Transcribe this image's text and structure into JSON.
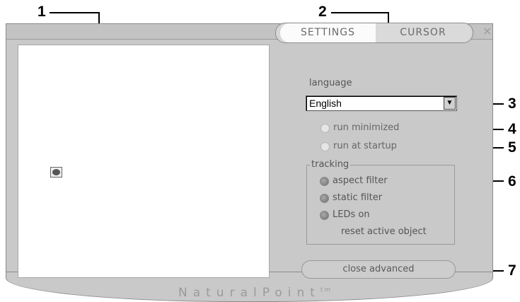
{
  "callouts": [
    "1",
    "2",
    "3",
    "4",
    "5",
    "6",
    "7"
  ],
  "titlebar": {
    "minimize_symbol": "–",
    "close_symbol": "×"
  },
  "tabs": {
    "settings": "SETTINGS",
    "cursor": "CURSOR"
  },
  "language": {
    "label": "language",
    "selected": "English",
    "arrow_symbol": "▼"
  },
  "options": {
    "run_minimized": "run minimized",
    "run_at_startup": "run at startup"
  },
  "tracking": {
    "title": "tracking",
    "aspect_filter": "aspect filter",
    "static_filter": "static filter",
    "leds_on": "LEDs on",
    "reset_active_object": "reset active object"
  },
  "close_advanced": "close advanced",
  "brand": {
    "name": "NaturalPoint",
    "tm": "tm"
  },
  "colors": {
    "window": "#c9c9c9",
    "preview": "#ffffff",
    "text": "#555555"
  }
}
